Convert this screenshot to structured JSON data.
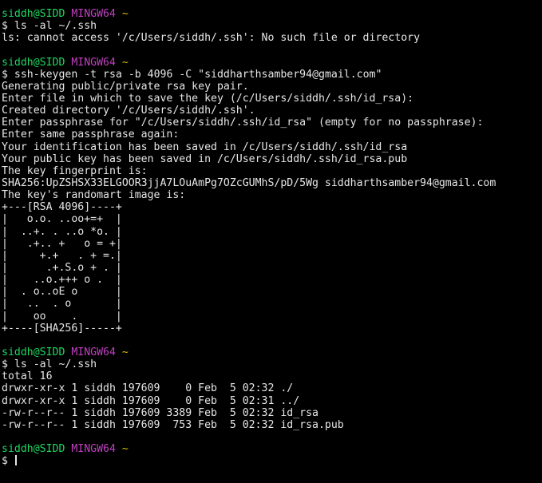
{
  "prompt": {
    "user": "siddh@SIDD",
    "shell": "MINGW64",
    "path": "~",
    "symbol": "$"
  },
  "blocks": [
    {
      "command": "ls -al ~/.ssh",
      "output": [
        "ls: cannot access '/c/Users/siddh/.ssh': No such file or directory"
      ]
    },
    {
      "command": "ssh-keygen -t rsa -b 4096 -C \"siddharthsamber94@gmail.com\"",
      "output": [
        "Generating public/private rsa key pair.",
        "Enter file in which to save the key (/c/Users/siddh/.ssh/id_rsa):",
        "Created directory '/c/Users/siddh/.ssh'.",
        "Enter passphrase for \"/c/Users/siddh/.ssh/id_rsa\" (empty for no passphrase):",
        "Enter same passphrase again:",
        "Your identification has been saved in /c/Users/siddh/.ssh/id_rsa",
        "Your public key has been saved in /c/Users/siddh/.ssh/id_rsa.pub",
        "The key fingerprint is:",
        "SHA256:UpZSHSX33ELGOOR3jjA7LOuAmPg7OZcGUMhS/pD/5Wg siddharthsamber94@gmail.com",
        "The key's randomart image is:",
        "+---[RSA 4096]----+",
        "|   o.o. ..oo+=+  |",
        "|  ..+. . ..o *o. |",
        "|   .+.. +   o = +|",
        "|     +.+   . + =.|",
        "|      .+.S.o + . |",
        "|    ..o.+++ o .  |",
        "|  . o..oE o      |",
        "|   ..  . o       |",
        "|    oo    .      |",
        "+----[SHA256]-----+"
      ]
    },
    {
      "command": "ls -al ~/.ssh",
      "output": [
        "total 16",
        "drwxr-xr-x 1 siddh 197609    0 Feb  5 02:32 ./",
        "drwxr-xr-x 1 siddh 197609    0 Feb  5 02:31 ../",
        "-rw-r--r-- 1 siddh 197609 3389 Feb  5 02:32 id_rsa",
        "-rw-r--r-- 1 siddh 197609  753 Feb  5 02:32 id_rsa.pub"
      ]
    }
  ],
  "current_input": ""
}
